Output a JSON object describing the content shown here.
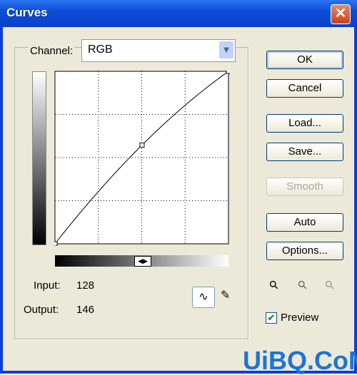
{
  "window": {
    "title": "Curves"
  },
  "channel": {
    "label": "Channel:",
    "value": "RGB"
  },
  "buttons": {
    "ok": "OK",
    "cancel": "Cancel",
    "load": "Load...",
    "save": "Save...",
    "smooth": "Smooth",
    "auto": "Auto",
    "options": "Options..."
  },
  "readout": {
    "input_label": "Input:",
    "input_value": "128",
    "output_label": "Output:",
    "output_value": "146"
  },
  "preview": {
    "label": "Preview",
    "checked": true
  },
  "curve": {
    "points": [
      [
        0,
        0
      ],
      [
        128,
        146
      ],
      [
        255,
        255
      ]
    ]
  },
  "watermark": "UiBQ.CoM"
}
